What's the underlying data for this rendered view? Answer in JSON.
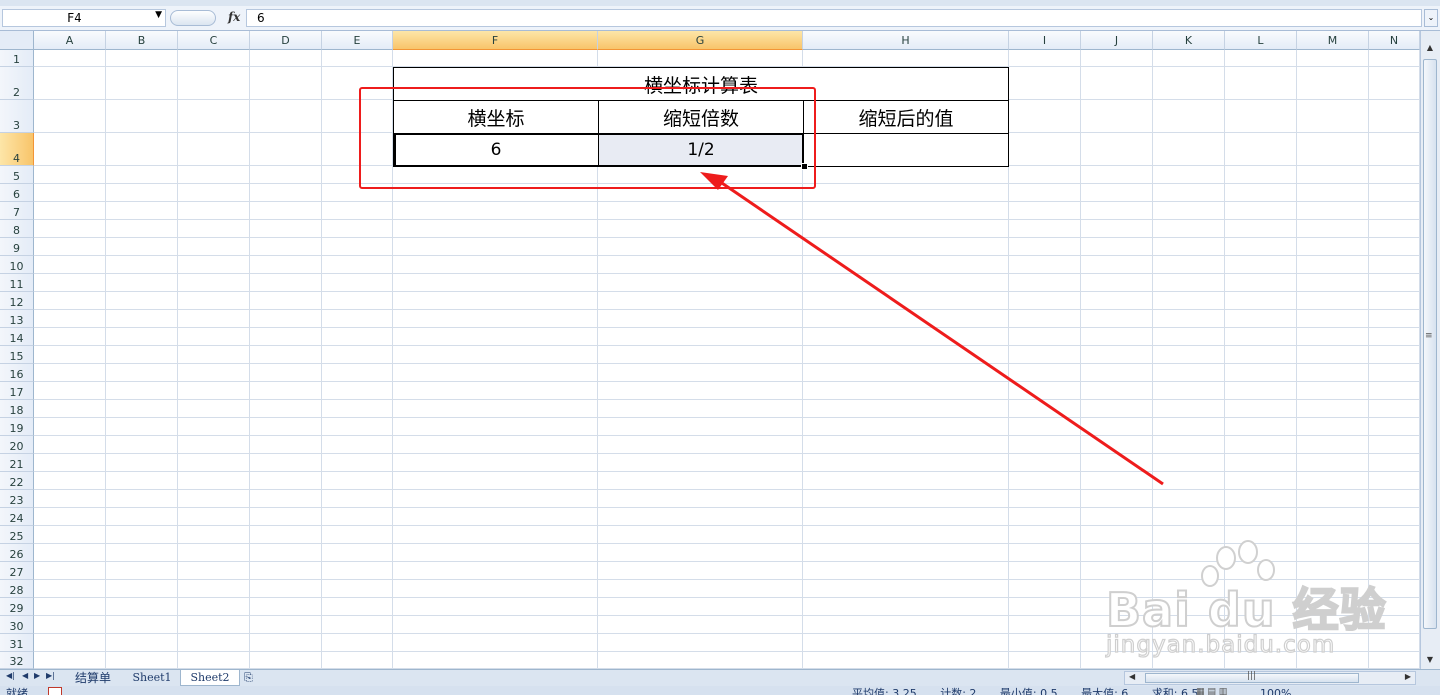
{
  "formula_bar": {
    "name_box": "F4",
    "fx_label": "fx",
    "formula_value": "6"
  },
  "columns": [
    "A",
    "B",
    "C",
    "D",
    "E",
    "F",
    "G",
    "H",
    "I",
    "J",
    "K",
    "L",
    "M",
    "N"
  ],
  "rows": [
    "1",
    "2",
    "3",
    "4",
    "5",
    "6",
    "7",
    "8",
    "9",
    "10",
    "11",
    "12",
    "13",
    "14",
    "15",
    "16",
    "17",
    "18",
    "19",
    "20",
    "21",
    "22",
    "23",
    "24",
    "25",
    "26",
    "27",
    "28",
    "29",
    "30",
    "31",
    "32"
  ],
  "table": {
    "title": "横坐标计算表",
    "headers": [
      "横坐标",
      "缩短倍数",
      "缩短后的值"
    ],
    "values": [
      "6",
      "1/2",
      ""
    ]
  },
  "annotation": {
    "highlight_color": "#ee1c1c"
  },
  "watermark": {
    "brand": "Bai du 经验",
    "url": "jingyan.baidu.com"
  },
  "sheet_tabs": [
    "结算单",
    "Sheet1",
    "Sheet2"
  ],
  "status_bar": {
    "ready": "就绪",
    "average": "平均值: 3.25",
    "count": "计数: 2",
    "min": "最小值: 0.5",
    "max": "最大值: 6",
    "sum": "求和: 6.5",
    "zoom": "100%"
  },
  "icons": {
    "dropdown": "chevron-down-icon",
    "fx": "function-icon",
    "sheet_nav": [
      "first-sheet-icon",
      "prev-sheet-icon",
      "next-sheet-icon",
      "last-sheet-icon"
    ],
    "new_sheet": "insert-sheet-icon"
  }
}
